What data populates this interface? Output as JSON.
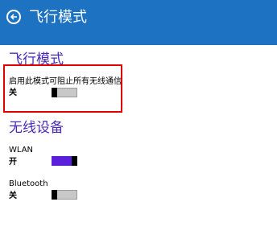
{
  "header": {
    "title": "飞行模式",
    "back_icon": "back-arrow-icon",
    "bg_color": "#1d73c2"
  },
  "airplane": {
    "section_title": "飞行模式",
    "description": "启用此模式可阻止所有无线通信",
    "state_label": "关",
    "toggle_on": false
  },
  "wireless": {
    "section_title": "无线设备",
    "devices": [
      {
        "name": "WLAN",
        "state_label": "开",
        "toggle_on": true
      },
      {
        "name": "Bluetooth",
        "state_label": "关",
        "toggle_on": false
      }
    ]
  },
  "colors": {
    "accent": "#4a2bb8",
    "toggle_on": "#5a1fd8",
    "highlight": "#e00000"
  }
}
